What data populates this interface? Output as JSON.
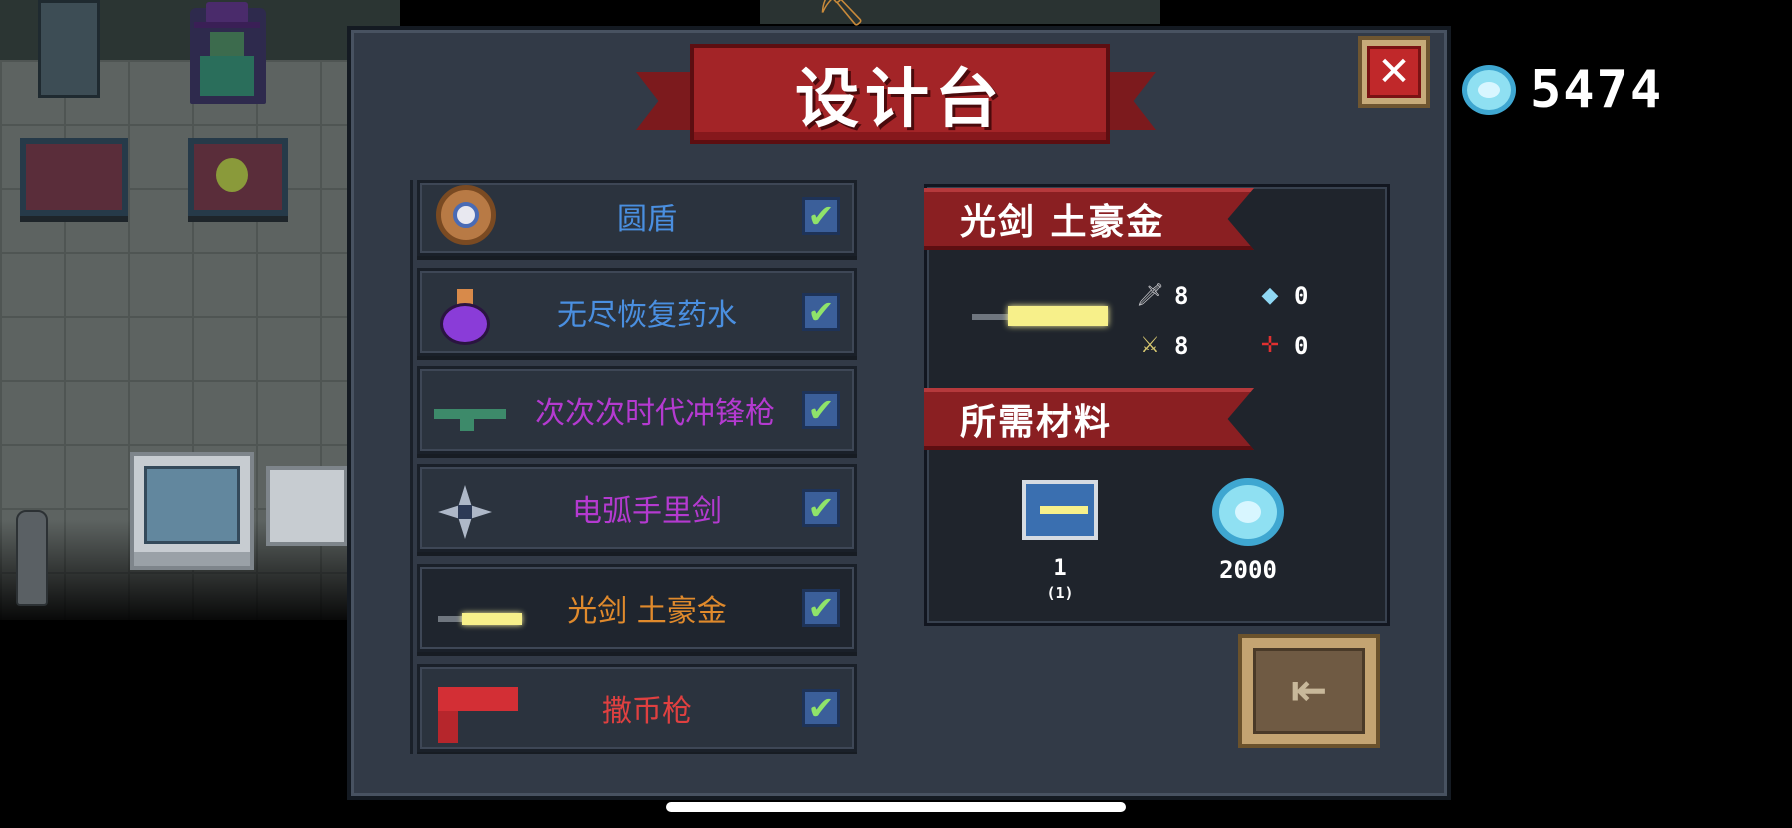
{
  "dialog": {
    "title": "设计台",
    "close_label": "✕",
    "exit_label": "⇤"
  },
  "currency": {
    "icon": "gem-icon",
    "value": "5474"
  },
  "items": [
    {
      "name": "圆盾",
      "color": "#4a8fe0",
      "icon": "round-shield-icon",
      "checked": true
    },
    {
      "name": "无尽恢复药水",
      "color": "#4a8fe0",
      "icon": "potion-icon",
      "checked": true
    },
    {
      "name": "次次次时代冲锋枪",
      "color": "#b43ad0",
      "icon": "smg-icon",
      "checked": true
    },
    {
      "name": "电弧手里剑",
      "color": "#b43ad0",
      "icon": "shuriken-icon",
      "checked": true
    },
    {
      "name": "光剑 土豪金",
      "color": "#e08a2c",
      "icon": "lightsaber-icon",
      "checked": true
    },
    {
      "name": "撒币枪",
      "color": "#e04040",
      "icon": "coin-gun-icon",
      "checked": true
    }
  ],
  "check_glyph": "✔",
  "detail": {
    "weapon_name": "光剑 土豪金",
    "stats": {
      "damage": "8",
      "energy": "0",
      "crit": "8",
      "accuracy": "0"
    },
    "materials_title": "所需材料",
    "materials": [
      {
        "icon": "blueprint-icon",
        "count": "1",
        "sub": "(1)"
      },
      {
        "icon": "gem-icon",
        "count": "2000"
      }
    ]
  }
}
